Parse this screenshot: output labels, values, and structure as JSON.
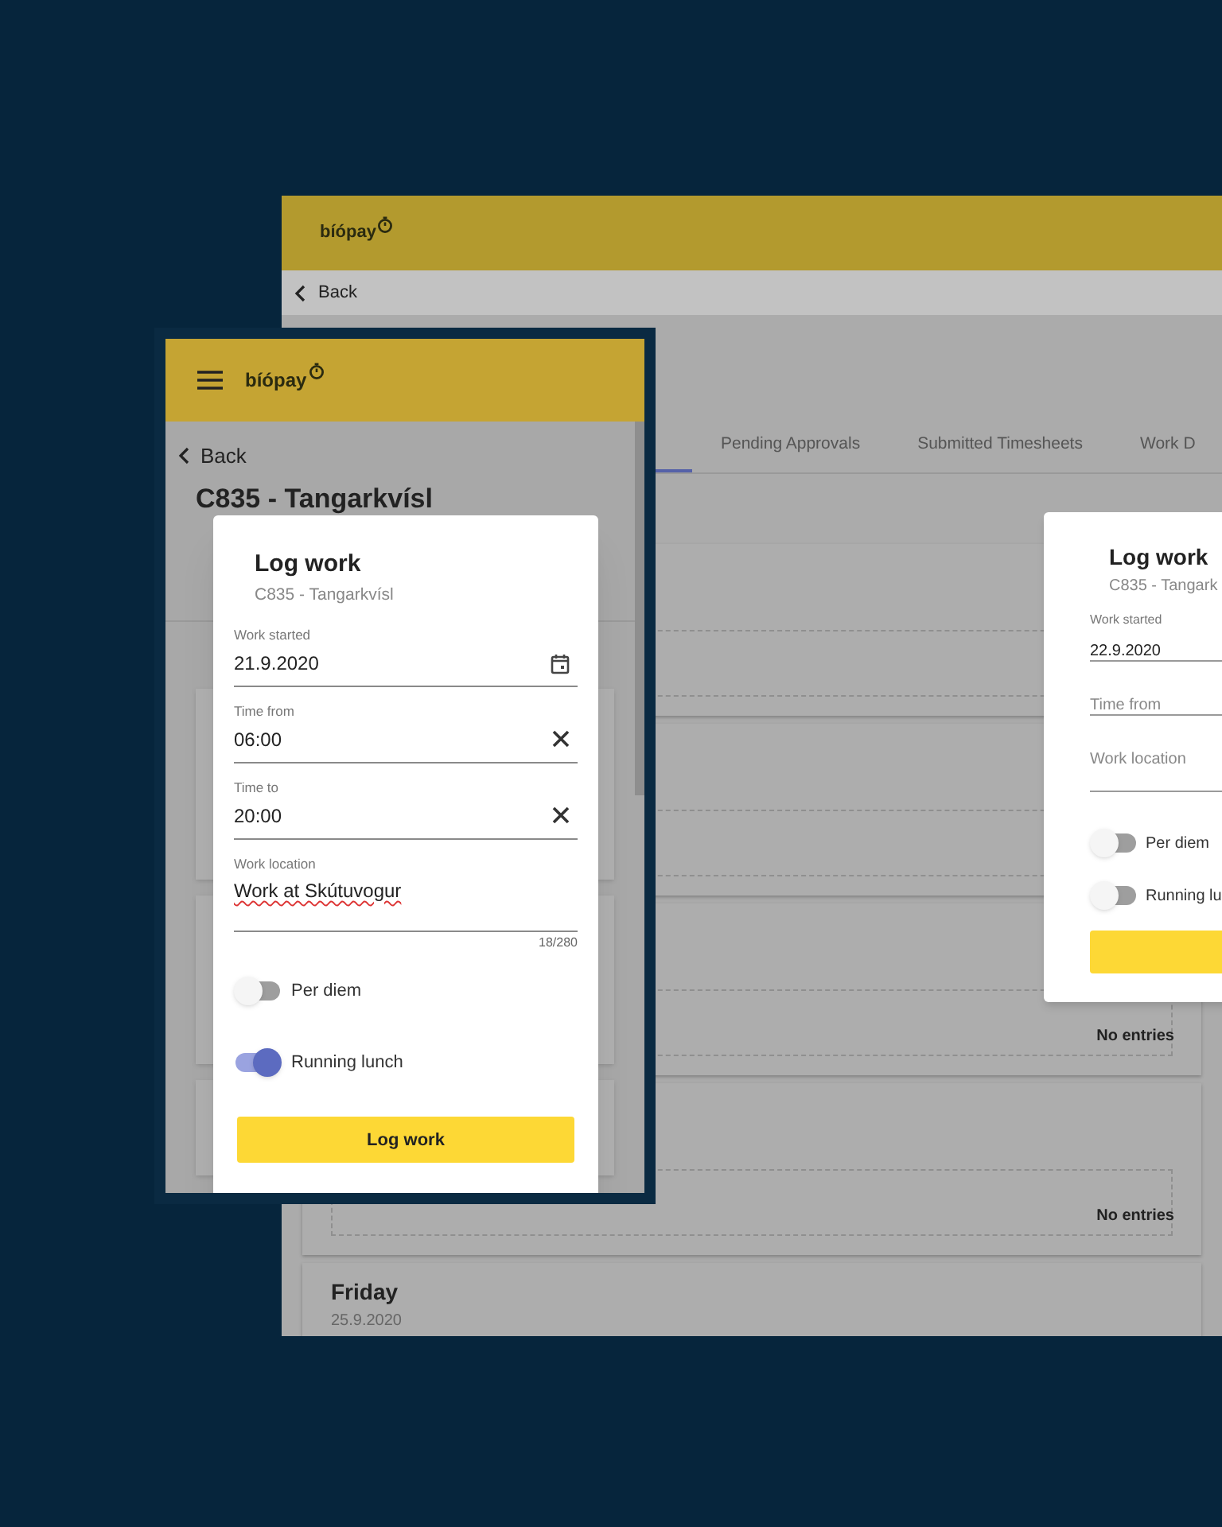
{
  "background_window": {
    "logo": "bíópay",
    "back": "Back",
    "tabs": [
      {
        "label": "Pending Approvals",
        "selected": false
      },
      {
        "label": "Submitted Timesheets",
        "selected": false
      },
      {
        "label": "Work D",
        "selected": false
      }
    ],
    "days": [
      {
        "kind": "blank"
      },
      {
        "kind": "blank"
      },
      {
        "kind": "note",
        "note": "No entries"
      },
      {
        "kind": "note",
        "note": "No entries"
      },
      {
        "kind": "heading",
        "day": "Friday",
        "date": "25.9.2020"
      }
    ],
    "dialog": {
      "title": "Log work",
      "subtitle": "C835 - Tangark",
      "fields": [
        {
          "kind": "date",
          "label": "Work started",
          "value": "22.9.2020"
        },
        {
          "kind": "time",
          "placeholder": "Time from"
        },
        {
          "kind": "text",
          "placeholder": "Work location"
        }
      ],
      "toggles": [
        {
          "label": "Per diem",
          "on": false
        },
        {
          "label": "Running lu",
          "on": false
        }
      ]
    }
  },
  "phone": {
    "logo": "bíópay",
    "back": "Back",
    "title": "C835 - Tangarkvísl",
    "dialog": {
      "title": "Log work",
      "subtitle": "C835 - Tangarkvísl",
      "fields": [
        {
          "kind": "date",
          "label": "Work started",
          "value": "21.9.2020"
        },
        {
          "kind": "time",
          "label": "Time from",
          "value": "06:00"
        },
        {
          "kind": "time",
          "label": "Time to",
          "value": "20:00"
        },
        {
          "kind": "textarea",
          "label": "Work location",
          "value": "Work at Skútuvogur",
          "counter": "18/280"
        }
      ],
      "toggles": [
        {
          "label": "Per diem",
          "on": false
        },
        {
          "label": "Running lunch",
          "on": true
        }
      ],
      "button": "Log work"
    }
  }
}
